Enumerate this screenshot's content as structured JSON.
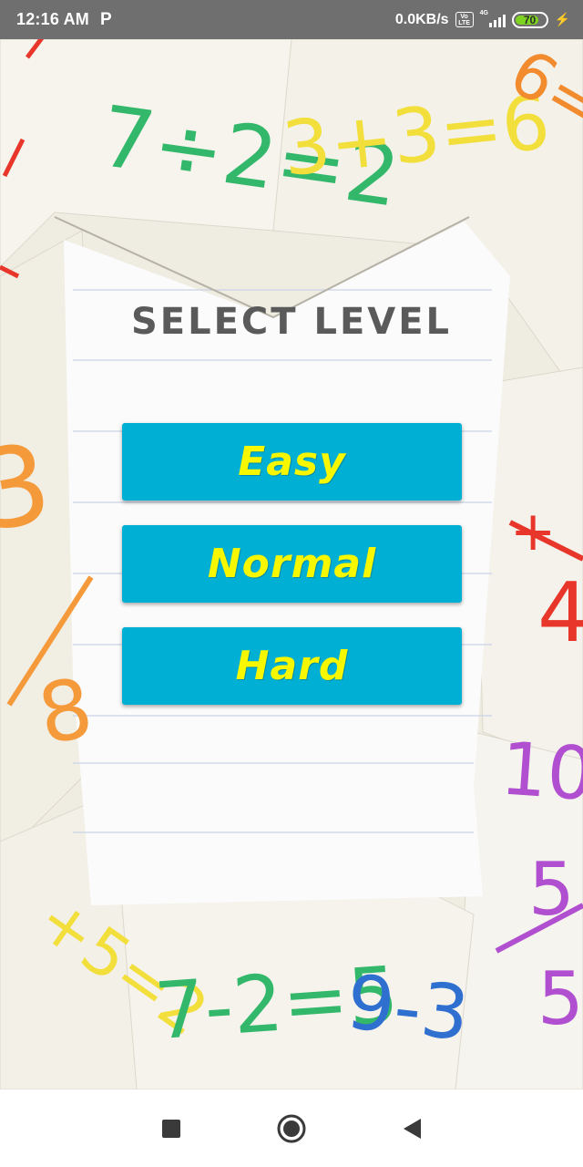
{
  "status_bar": {
    "time": "12:16 AM",
    "notification_icon": "p-icon",
    "notification_glyph": "P",
    "net_speed": "0.0KB/s",
    "volte_label_top": "Vo",
    "volte_label_bottom": "LTE",
    "network_type": "4G",
    "battery_level": "70",
    "battery_level_fraction": 0.7,
    "charging": true,
    "colors": {
      "background": "#6f6f6f",
      "battery_fill": "#7ed321"
    }
  },
  "screen": {
    "title": "SELECT LEVEL",
    "title_color": "#5a5a5a"
  },
  "levels": {
    "easy_label": "Easy",
    "normal_label": "Normal",
    "hard_label": "Hard",
    "button_color": "#00b0d4",
    "label_color": "#f7f700"
  },
  "background": {
    "texts": {
      "eq_top": "7÷2=2",
      "eq_top2": "3+3=6",
      "eq_bottom": "7-2=5",
      "eq_bottom2": "9-3"
    }
  },
  "navigation": {
    "recents_icon": "square-icon",
    "home_icon": "circle-icon",
    "back_icon": "triangle-back-icon"
  }
}
